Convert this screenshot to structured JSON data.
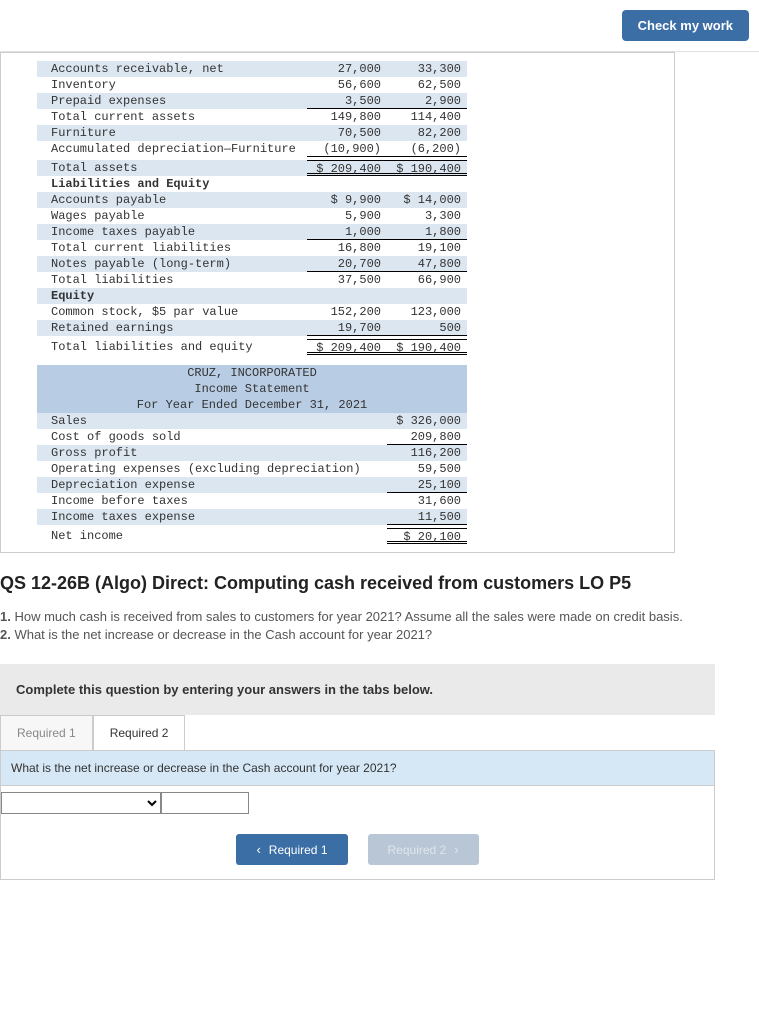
{
  "header": {
    "check_label": "Check my work"
  },
  "balance_sheet": [
    {
      "label": "Accounts receivable, net",
      "c1": "27,000",
      "c2": "33,300",
      "alt": 1
    },
    {
      "label": "Inventory",
      "c1": "56,600",
      "c2": "62,500",
      "alt": 0
    },
    {
      "label": "Prepaid expenses",
      "c1": "3,500",
      "c2": "2,900",
      "alt": 1,
      "underline": 1
    },
    {
      "label": "Total current assets",
      "c1": "149,800",
      "c2": "114,400",
      "alt": 0
    },
    {
      "label": "Furniture",
      "c1": "70,500",
      "c2": "82,200",
      "alt": 1
    },
    {
      "label": "Accumulated depreciation—Furniture",
      "c1": "(10,900)",
      "c2": "(6,200)",
      "alt": 0,
      "underline": 1
    },
    {
      "label": "Total assets",
      "c1": "$ 209,400",
      "c2": "$ 190,400",
      "alt": 1,
      "double": 1,
      "gap": 1
    },
    {
      "label": "Liabilities and Equity",
      "c1": "",
      "c2": "",
      "alt": 0,
      "bold": 1
    },
    {
      "label": "Accounts payable",
      "c1": "$ 9,900",
      "c2": "$ 14,000",
      "alt": 1
    },
    {
      "label": "Wages payable",
      "c1": "5,900",
      "c2": "3,300",
      "alt": 0
    },
    {
      "label": "Income taxes payable",
      "c1": "1,000",
      "c2": "1,800",
      "alt": 1,
      "underline": 1
    },
    {
      "label": "Total current liabilities",
      "c1": "16,800",
      "c2": "19,100",
      "alt": 0
    },
    {
      "label": "Notes payable (long-term)",
      "c1": "20,700",
      "c2": "47,800",
      "alt": 1,
      "underline": 1
    },
    {
      "label": "Total liabilities",
      "c1": "37,500",
      "c2": "66,900",
      "alt": 0
    },
    {
      "label": "Equity",
      "c1": "",
      "c2": "",
      "alt": 1,
      "bold": 1
    },
    {
      "label": "Common stock, $5 par value",
      "c1": "152,200",
      "c2": "123,000",
      "alt": 0
    },
    {
      "label": "Retained earnings",
      "c1": "19,700",
      "c2": "500",
      "alt": 1,
      "underline": 1
    },
    {
      "label": "Total liabilities and equity",
      "c1": "$ 209,400",
      "c2": "$ 190,400",
      "alt": 0,
      "double": 1,
      "gap": 1
    }
  ],
  "income_header": {
    "l1": "CRUZ, INCORPORATED",
    "l2": "Income Statement",
    "l3": "For Year Ended December 31, 2021"
  },
  "income_statement": [
    {
      "label": "Sales",
      "c1": "$ 326,000",
      "alt": 1
    },
    {
      "label": "Cost of goods sold",
      "c1": "209,800",
      "alt": 0,
      "underline": 1
    },
    {
      "label": "Gross profit",
      "c1": "116,200",
      "alt": 1
    },
    {
      "label": "Operating expenses (excluding depreciation)",
      "c1": "59,500",
      "alt": 0
    },
    {
      "label": "Depreciation expense",
      "c1": "25,100",
      "alt": 1,
      "underline": 1
    },
    {
      "label": "Income before taxes",
      "c1": "31,600",
      "alt": 0
    },
    {
      "label": "Income taxes expense",
      "c1": "11,500",
      "alt": 1,
      "underline": 1
    },
    {
      "label": "Net income",
      "c1": "$ 20,100",
      "alt": 0,
      "double": 1,
      "gap": 1
    }
  ],
  "question": {
    "title": "QS 12-26B (Algo) Direct: Computing cash received from customers LO P5",
    "q1_prefix": "1.",
    "q1": " How much cash is received from sales to customers for year 2021? Assume all the sales were made on credit basis.",
    "q2_prefix": "2.",
    "q2": " What is the net increase or decrease in the Cash account for year 2021?"
  },
  "answer": {
    "banner": "Complete this question by entering your answers in the tabs below.",
    "tab1": "Required 1",
    "tab2": "Required 2",
    "subq": "What is the net increase or decrease in the Cash account for year 2021?",
    "prev_label": "Required 1",
    "next_label": "Required 2"
  }
}
